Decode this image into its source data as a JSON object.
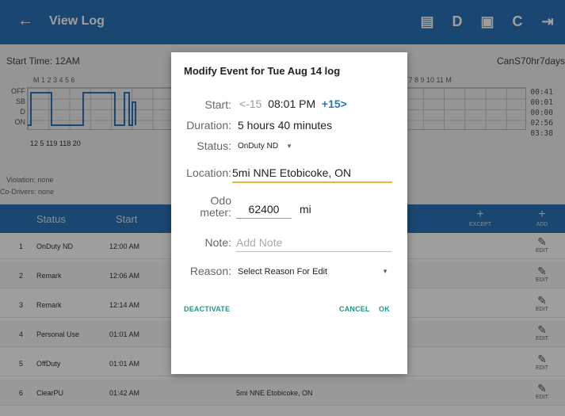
{
  "appbar": {
    "back_icon": "arrow-left-icon",
    "title": "View Log",
    "actions": [
      {
        "name": "message-icon",
        "glyph": "▬"
      },
      {
        "name": "d-icon",
        "glyph": "D"
      },
      {
        "name": "certify-icon",
        "glyph": "▣"
      },
      {
        "name": "refresh-icon",
        "glyph": "⟳"
      },
      {
        "name": "logout-icon",
        "glyph": "⇥"
      }
    ]
  },
  "log": {
    "start_time": "Start Time: 12AM",
    "ruleset": "CanS70hr7days",
    "hour_labels": "M   1   2   3   4   5   6",
    "hour_labels_right": "6   7   8   9   10  11   M",
    "row_labels": [
      "OFF",
      "SB",
      "D",
      "ON"
    ],
    "totals": [
      "00:41",
      "00:01",
      "00:00",
      "02:56",
      "03:38"
    ],
    "durations": "12  5  119  118  20",
    "violation": "Violation: none",
    "codrivers": "Co-Drivers: none"
  },
  "table": {
    "headers": {
      "status": "Status",
      "start": "Start"
    },
    "except_label": "EXCEPT",
    "add_label": "ADD",
    "edit_label": "EDIT",
    "rows": [
      {
        "num": "1",
        "status": "OnDuty ND",
        "start": "12:00 AM",
        "location": ""
      },
      {
        "num": "2",
        "status": "Remark",
        "start": "12:06 AM",
        "location": ""
      },
      {
        "num": "3",
        "status": "Remark",
        "start": "12:14 AM",
        "location": ""
      },
      {
        "num": "4",
        "status": "Personal Use",
        "start": "01:01 AM",
        "location": ""
      },
      {
        "num": "5",
        "status": "OffDuty",
        "start": "01:01 AM",
        "location": ""
      },
      {
        "num": "6",
        "status": "ClearPU",
        "start": "01:42 AM",
        "location": "5mi NNE Etobicoke, ON"
      }
    ]
  },
  "dialog": {
    "title": "Modify Event for Tue Aug 14 log",
    "start_label": "Start:",
    "minus": "-15",
    "start_value": "08:01 PM",
    "plus": "+15",
    "duration_label": "Duration:",
    "duration_value": "5 hours 40 minutes",
    "status_label": "Status:",
    "status_value": "OnDuty ND",
    "location_label": "Location:",
    "location_value": "5mi NNE Etobicoke, ON",
    "odo_label_1": "Odo",
    "odo_label_2": "meter:",
    "odo_value": "62400",
    "odo_unit": "mi",
    "note_label": "Note:",
    "note_placeholder": "Add Note",
    "reason_label": "Reason:",
    "reason_value": "Select Reason For Edit",
    "deactivate": "DEACTIVATE",
    "cancel": "CANCEL",
    "ok": "OK"
  },
  "colors": {
    "primary": "#2b73b6",
    "accent_text": "#1e9688",
    "field_underline": "#e0b843"
  }
}
